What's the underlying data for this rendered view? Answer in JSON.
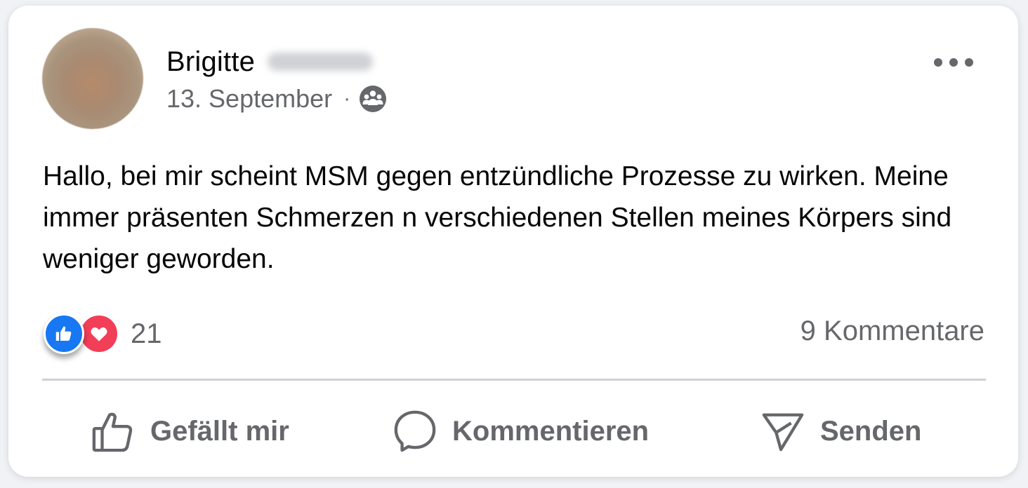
{
  "post": {
    "author_name": "Brigitte",
    "date": "13. September",
    "separator": "·",
    "audience_icon": "group-icon",
    "body": "Hallo, bei mir scheint MSM gegen entzündliche Prozesse zu wirken. Meine immer präsenten Schmerzen n verschiedenen Stellen meines Körpers sind weniger geworden."
  },
  "stats": {
    "reaction_count": "21",
    "comments_label": "9 Kommentare"
  },
  "actions": {
    "like_label": "Gefällt mir",
    "comment_label": "Kommentieren",
    "send_label": "Senden"
  },
  "colors": {
    "like_blue": "#1877f2",
    "love_red": "#f33e58",
    "secondary_text": "#65676b"
  }
}
